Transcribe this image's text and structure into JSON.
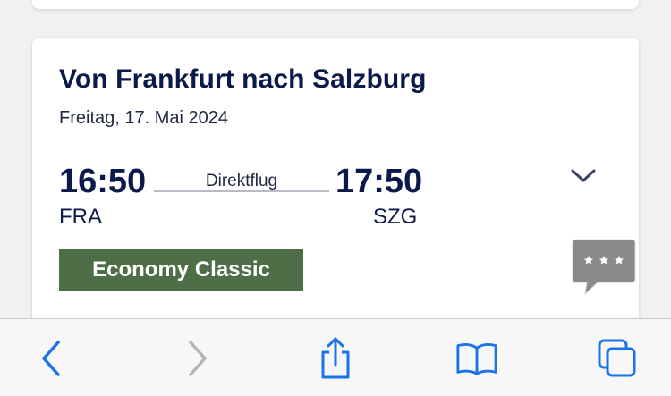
{
  "flight": {
    "title": "Von Frankfurt nach Salzburg",
    "date": "Freitag, 17. Mai 2024",
    "departure_time": "16:50",
    "departure_airport": "FRA",
    "arrival_time": "17:50",
    "arrival_airport": "SZG",
    "flight_type": "Direktflug",
    "fare_class": "Economy Classic"
  },
  "icons": {
    "expand": "chevron-down-icon",
    "chat": "chat-bubble-icon",
    "back": "chevron-left-icon",
    "forward": "chevron-right-icon",
    "share": "share-icon",
    "bookmarks": "book-icon",
    "tabs": "tabs-icon"
  },
  "colors": {
    "title": "#0b1a4a",
    "fare_badge": "#4d6e46",
    "toolbar_active": "#1a73e8",
    "toolbar_disabled": "#b5b5b8",
    "chat_bubble": "#8a8a8a"
  }
}
